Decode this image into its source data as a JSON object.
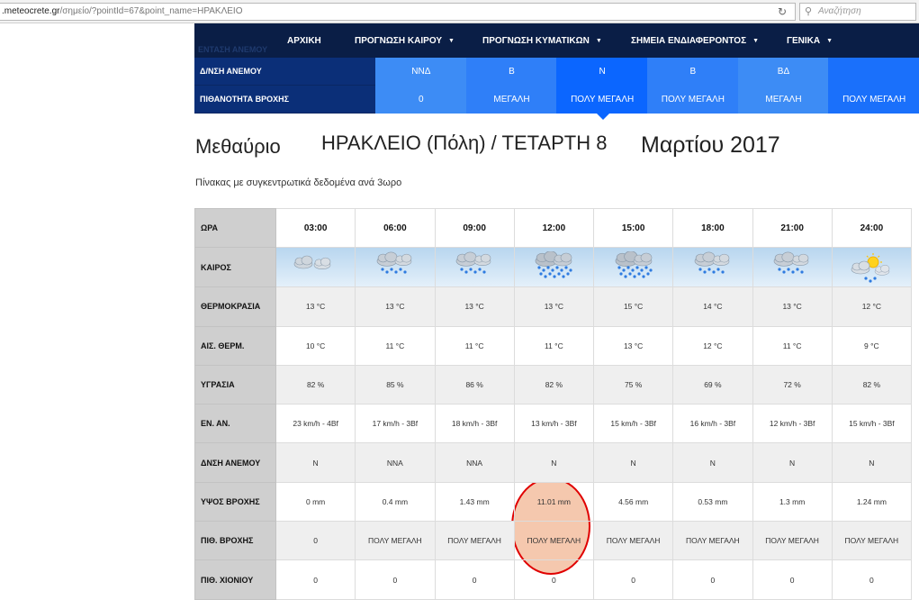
{
  "browser": {
    "url_host": ".meteocrete.gr",
    "url_path": "/σημείο/?pointId=67&point_name=ΗΡΑΚΛΕΙΟ",
    "search_placeholder": "Αναζήτηση"
  },
  "nav": {
    "items": [
      {
        "label": "ΑΡΧΙΚΗ",
        "has_caret": false
      },
      {
        "label": "ΠΡΟΓΝΩΣΗ ΚΑΙΡΟΥ",
        "has_caret": true
      },
      {
        "label": "ΠΡΟΓΝΩΣΗ ΚΥΜΑΤΙΚΩΝ",
        "has_caret": true
      },
      {
        "label": "ΣΗΜΕΙΑ ΕΝΔΙΑΦΕΡΟΝΤΟΣ",
        "has_caret": true
      },
      {
        "label": "ΓΕΝΙΚΑ",
        "has_caret": true
      }
    ],
    "ghost_text": "ΕΝΤΑΣΗ ΑΝΕΜΟΥ"
  },
  "strip": {
    "wind_dir_label": "Δ/ΝΣΗ ΑΝΕΜΟΥ",
    "rain_prob_label": "ΠΙΘΑΝΟΤΗΤΑ ΒΡΟΧΗΣ",
    "wind_dir": [
      "ΝΝΔ",
      "Β",
      "Ν",
      "Β",
      "ΒΔ",
      ""
    ],
    "rain_prob": [
      "0",
      "ΜΕΓΑΛΗ",
      "ΠΟΛΥ ΜΕΓΑΛΗ",
      "ΠΟΛΥ ΜΕΓΑΛΗ",
      "ΜΕΓΑΛΗ",
      "ΠΟΛΥ ΜΕΓΑΛΗ"
    ],
    "colors": [
      "#3d8cf5",
      "#2f7ff8",
      "#0b66ff",
      "#2f7ff8",
      "#3d8cf5",
      "#1a70fb"
    ]
  },
  "heading": {
    "day": "Μεθαύριο",
    "place": "ΗΡΑΚΛΕΙΟ (Πόλη) / ΤΕΤΑΡΤΗ 8",
    "date": "Μαρτίου 2017"
  },
  "subtitle": "Πίνακας με συγκεντρωτικά δεδομένα ανά 3ωρο",
  "table": {
    "hours_label": "ΩΡΑ",
    "hours": [
      "03:00",
      "06:00",
      "09:00",
      "12:00",
      "15:00",
      "18:00",
      "21:00",
      "24:00"
    ],
    "weather_label": "ΚΑΙΡΟΣ",
    "weather_icons": [
      "cloudy-icon",
      "rain-icon",
      "rain-icon",
      "heavy-rain-icon",
      "heavy-rain-icon",
      "rain-icon",
      "rain-icon",
      "sun-cloud-icon"
    ],
    "rows": [
      {
        "label": "ΘΕΡΜΟΚΡΑΣΙΑ",
        "values": [
          "13 °C",
          "13 °C",
          "13 °C",
          "13 °C",
          "15 °C",
          "14 °C",
          "13 °C",
          "12 °C"
        ]
      },
      {
        "label": "ΑΙΣ. ΘΕΡΜ.",
        "values": [
          "10 °C",
          "11 °C",
          "11 °C",
          "11 °C",
          "13 °C",
          "12 °C",
          "11 °C",
          "9 °C"
        ]
      },
      {
        "label": "ΥΓΡΑΣΙΑ",
        "values": [
          "82 %",
          "85 %",
          "86 %",
          "82 %",
          "75 %",
          "69 %",
          "72 %",
          "82 %"
        ]
      },
      {
        "label": "ΕΝ. ΑΝ.",
        "values": [
          "23 km/h - 4Bf",
          "17 km/h - 3Bf",
          "18 km/h - 3Bf",
          "13 km/h - 3Bf",
          "15 km/h - 3Bf",
          "16 km/h - 3Bf",
          "12 km/h - 3Bf",
          "15 km/h - 3Bf"
        ]
      },
      {
        "label": "ΔΝΣΗ ΑΝΕΜΟΥ",
        "values": [
          "N",
          "NNA",
          "NNA",
          "N",
          "N",
          "N",
          "N",
          "N"
        ]
      },
      {
        "label": "ΥΨΟΣ ΒΡΟΧΗΣ",
        "values": [
          "0 mm",
          "0.4 mm",
          "1.43 mm",
          "11.01 mm",
          "4.56 mm",
          "0.53 mm",
          "1.3 mm",
          "1.24 mm"
        ]
      },
      {
        "label": "ΠΙΘ. ΒΡΟΧΗΣ",
        "values": [
          "0",
          "ΠΟΛΥ ΜΕΓΑΛΗ",
          "ΠΟΛΥ ΜΕΓΑΛΗ",
          "ΠΟΛΥ ΜΕΓΑΛΗ",
          "ΠΟΛΥ ΜΕΓΑΛΗ",
          "ΠΟΛΥ ΜΕΓΑΛΗ",
          "ΠΟΛΥ ΜΕΓΑΛΗ",
          "ΠΟΛΥ ΜΕΓΑΛΗ"
        ]
      },
      {
        "label": "ΠΙΘ. ΧΙΟΝΙΟΥ",
        "values": [
          "0",
          "0",
          "0",
          "0",
          "0",
          "0",
          "0",
          "0"
        ]
      }
    ],
    "highlight_color": "#e00000"
  }
}
